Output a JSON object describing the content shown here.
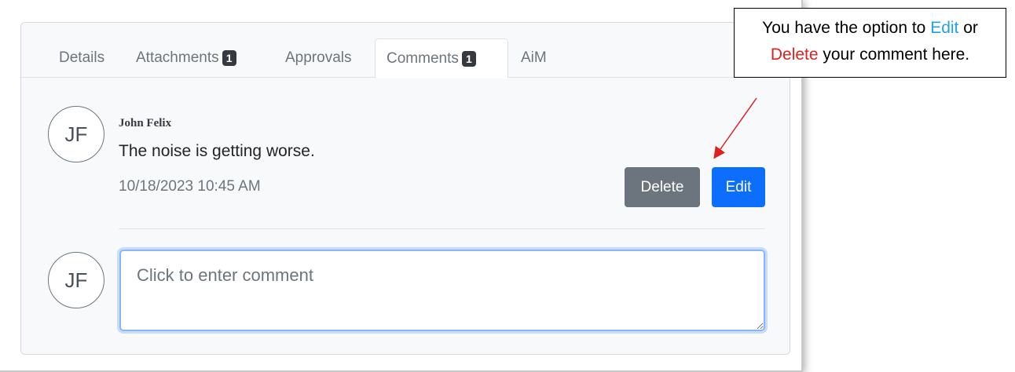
{
  "tabs": [
    {
      "label": "Details",
      "badge": null,
      "active": false
    },
    {
      "label": "Attachments",
      "badge": "1",
      "active": false
    },
    {
      "label": "Approvals",
      "badge": null,
      "active": false
    },
    {
      "label": "Comments",
      "badge": "1",
      "active": true
    },
    {
      "label": "AiM",
      "badge": null,
      "active": false
    }
  ],
  "comment": {
    "avatar_initials": "JF",
    "author": "John Felix",
    "text": "The noise is getting worse.",
    "timestamp": "10/18/2023 10:45 AM",
    "delete_label": "Delete",
    "edit_label": "Edit"
  },
  "new_comment": {
    "avatar_initials": "JF",
    "placeholder": "Click to enter comment",
    "value": ""
  },
  "callout": {
    "part1": "You have the option to ",
    "edit_word": "Edit",
    "part2": " or",
    "delete_word": "Delete",
    "part3": " your comment here."
  },
  "colors": {
    "edit_button": "#0d6efd",
    "delete_button": "#6c757d",
    "callout_edit": "#1fa2e8",
    "callout_delete": "#e02020",
    "arrow": "#e02020"
  }
}
